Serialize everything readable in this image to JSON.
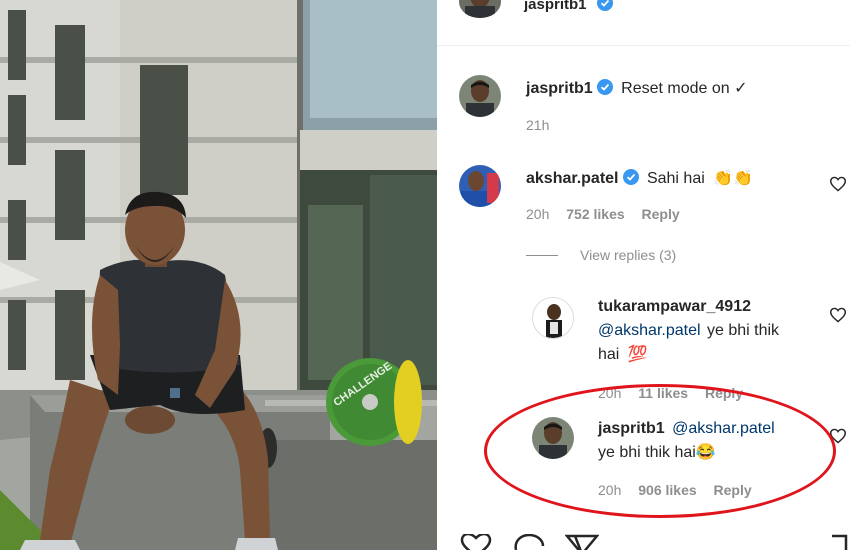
{
  "post": {
    "author": "jaspritb1",
    "caption_user": "jaspritb1",
    "caption_text": "Reset mode on ✓",
    "caption_time": "21h"
  },
  "comments": [
    {
      "user": "akshar.patel",
      "verified": true,
      "text": "Sahi hai",
      "emoji": "👏👏",
      "time": "20h",
      "likes": "752 likes",
      "reply_label": "Reply",
      "view_replies": "View replies (3)"
    }
  ],
  "replies": [
    {
      "user": "tukarampawar_4912",
      "mention": "@akshar.patel",
      "text": "ye bhi thik",
      "text2": "hai",
      "emoji": "💯",
      "time": "20h",
      "likes": "11 likes",
      "reply_label": "Reply"
    },
    {
      "user": "jaspritb1",
      "mention": "@akshar.patel",
      "text": "ye bhi thik hai",
      "emoji": "😂",
      "time": "20h",
      "likes": "906 likes",
      "reply_label": "Reply"
    }
  ],
  "photo": {
    "plate_text": "CHALLENGE"
  },
  "icons": {
    "verified": "verified-badge-icon",
    "like": "heart-icon",
    "comment": "comment-icon",
    "share": "share-icon",
    "save": "bookmark-icon"
  },
  "colors": {
    "verified": "#3897f0",
    "highlight": "#e0141b",
    "mention": "#00376b",
    "muted": "#8e8e8e"
  }
}
